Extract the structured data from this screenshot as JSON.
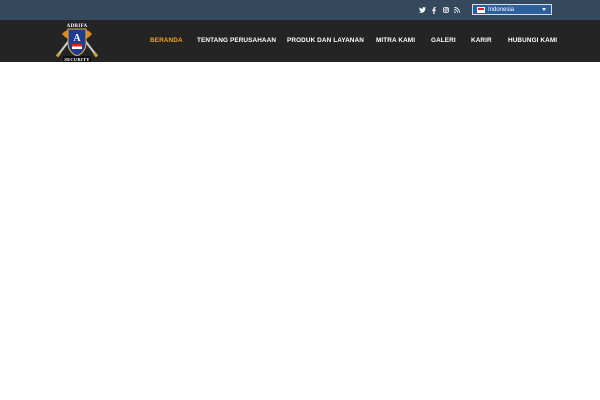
{
  "topbar": {
    "social": [
      {
        "icon": "twitter-icon"
      },
      {
        "icon": "facebook-icon"
      },
      {
        "icon": "instagram-icon"
      },
      {
        "icon": "rss-icon"
      }
    ],
    "language": {
      "selected": "Indonesia",
      "flag": "indonesia-flag-icon"
    }
  },
  "logo": {
    "top_text": "ADRIFA",
    "bottom_text": "SECURITY",
    "badge_letter": "A"
  },
  "nav": {
    "items": [
      {
        "label": "BERANDA",
        "active": true
      },
      {
        "label": "TENTANG PERUSAHAAN"
      },
      {
        "label": "PRODUK DAN LAYANAN"
      },
      {
        "label": "MITRA KAMI"
      },
      {
        "label": "GALERI"
      },
      {
        "label": "KARIR"
      },
      {
        "label": "HUBUNGI KAMI"
      }
    ]
  },
  "colors": {
    "topbar_bg": "#34495e",
    "header_bg": "#242424",
    "active_nav": "#f0a01e",
    "nav_text": "#ffffff"
  }
}
